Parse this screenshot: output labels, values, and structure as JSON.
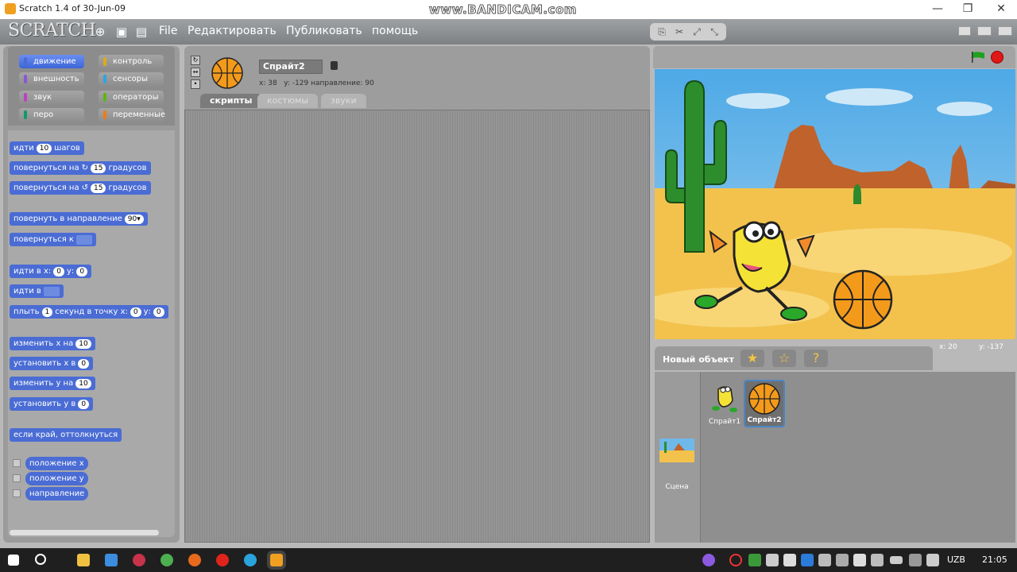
{
  "window": {
    "title": "Scratch 1.4 of 30-Jun-09",
    "watermark": "www.BANDICAM.com",
    "minimize": "—",
    "maximize": "❐",
    "close": "✕"
  },
  "menubar": {
    "logo": "SCRATCH",
    "items": [
      "File",
      "Редактировать",
      "Публиковать",
      "помощь"
    ]
  },
  "categories": [
    {
      "label": "движение",
      "color": "#4a6cd4",
      "active": true
    },
    {
      "label": "контроль",
      "color": "#e1a91a"
    },
    {
      "label": "внешность",
      "color": "#8a55d7"
    },
    {
      "label": "сенсоры",
      "color": "#2ca5e2"
    },
    {
      "label": "звук",
      "color": "#bb42c3"
    },
    {
      "label": "операторы",
      "color": "#5cb712"
    },
    {
      "label": "перо",
      "color": "#0e9a6c"
    },
    {
      "label": "переменные",
      "color": "#ee7d16"
    }
  ],
  "blocks": {
    "move": {
      "pre": "идти",
      "val": "10",
      "post": "шагов"
    },
    "turn_right": {
      "pre": "повернуться на",
      "val": "15",
      "post": "градусов"
    },
    "turn_left": {
      "pre": "повернуться на",
      "val": "15",
      "post": "градусов"
    },
    "point_dir": {
      "pre": "повернуть в направление",
      "val": "90▾"
    },
    "point_towards": {
      "pre": "повернуться к"
    },
    "goto_xy": {
      "pre": "идти в х:",
      "x": "0",
      "mid": "у:",
      "y": "0"
    },
    "goto": {
      "pre": "идти в"
    },
    "glide": {
      "pre": "плыть",
      "secs": "1",
      "mid": "секунд в точку х:",
      "x": "0",
      "mid2": "у:",
      "y": "0"
    },
    "change_x": {
      "pre": "изменить х на",
      "val": "10"
    },
    "set_x": {
      "pre": "установить х в",
      "val": "0"
    },
    "change_y": {
      "pre": "изменить у на",
      "val": "10"
    },
    "set_y": {
      "pre": "установить у в",
      "val": "0"
    },
    "bounce": {
      "label": "если край, оттолкнуться"
    },
    "reporters": [
      "положение х",
      "положение у",
      "направление"
    ]
  },
  "sprite_header": {
    "name": "Спрайт2",
    "info": "x: 38   y: -129 направление: 90",
    "tabs": [
      "скрипты",
      "костюмы",
      "звуки"
    ]
  },
  "stage": {
    "coord_x": "x: 20",
    "coord_y": "y: -137"
  },
  "new_object": {
    "label": "Новый объект"
  },
  "sprites": [
    {
      "label": "Спрайт1"
    },
    {
      "label": "Спрайт2",
      "selected": true
    }
  ],
  "stage_thumb_label": "Сцена",
  "taskbar": {
    "lang": "UZB",
    "time": "21:05"
  }
}
